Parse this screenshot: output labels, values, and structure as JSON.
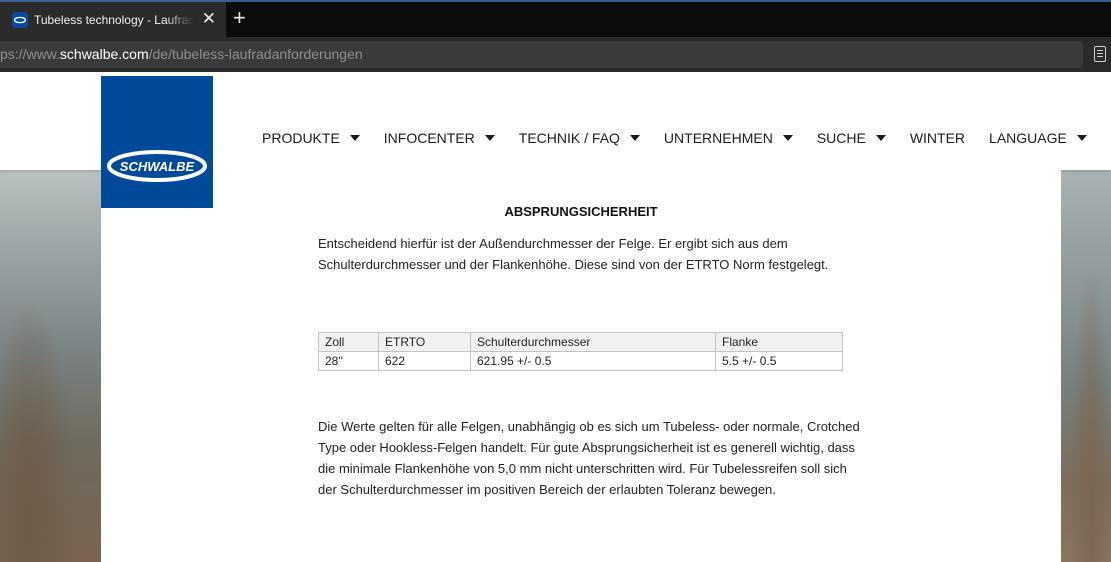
{
  "browser": {
    "tab_title": "Tubeless technology - Laufradanforderungen",
    "close_glyph": "✕",
    "newtab_glyph": "+",
    "url_prefix": "ps://www.",
    "url_domain": "schwalbe.com",
    "url_path": "/de/tubeless-laufradanforderungen",
    "reader_icon": "reader-view-icon"
  },
  "site": {
    "logo_text": "SCHWALBE",
    "brand_color": "#004a99",
    "nav": [
      {
        "label": "PRODUKTE",
        "has_menu": true
      },
      {
        "label": "INFOCENTER",
        "has_menu": true
      },
      {
        "label": "TECHNIK / FAQ",
        "has_menu": true
      },
      {
        "label": "UNTERNEHMEN",
        "has_menu": true
      },
      {
        "label": "SUCHE",
        "has_menu": true
      },
      {
        "label": "WINTER",
        "has_menu": false
      },
      {
        "label": "LANGUAGE",
        "has_menu": true
      }
    ]
  },
  "content": {
    "heading": "ABSPRUNGSICHERHEIT",
    "intro": "Entscheidend hierfür ist der Außendurchmesser der Felge. Er ergibt sich aus dem Schulterdurchmesser und der Flankenhöhe. Diese sind von der ETRTO Norm festgelegt.",
    "table": {
      "headers": [
        "Zoll",
        "ETRTO",
        "Schulterdurchmesser",
        "Flanke"
      ],
      "rows": [
        [
          "28''",
          "622",
          "621.95 +/- 0.5",
          "5.5 +/- 0.5"
        ]
      ]
    },
    "body": "Die Werte gelten für alle Felgen, unabhängig ob es sich um Tubeless- oder normale, Crotched Type oder Hookless-Felgen handelt. Für gute Absprungsicherheit ist es generell wichtig, dass die minimale Flankenhöhe von 5,0 mm nicht unterschritten wird. Für Tubelessreifen soll sich der Schulterdurchmesser im positiven Bereich der erlaubten Toleranz bewegen."
  }
}
